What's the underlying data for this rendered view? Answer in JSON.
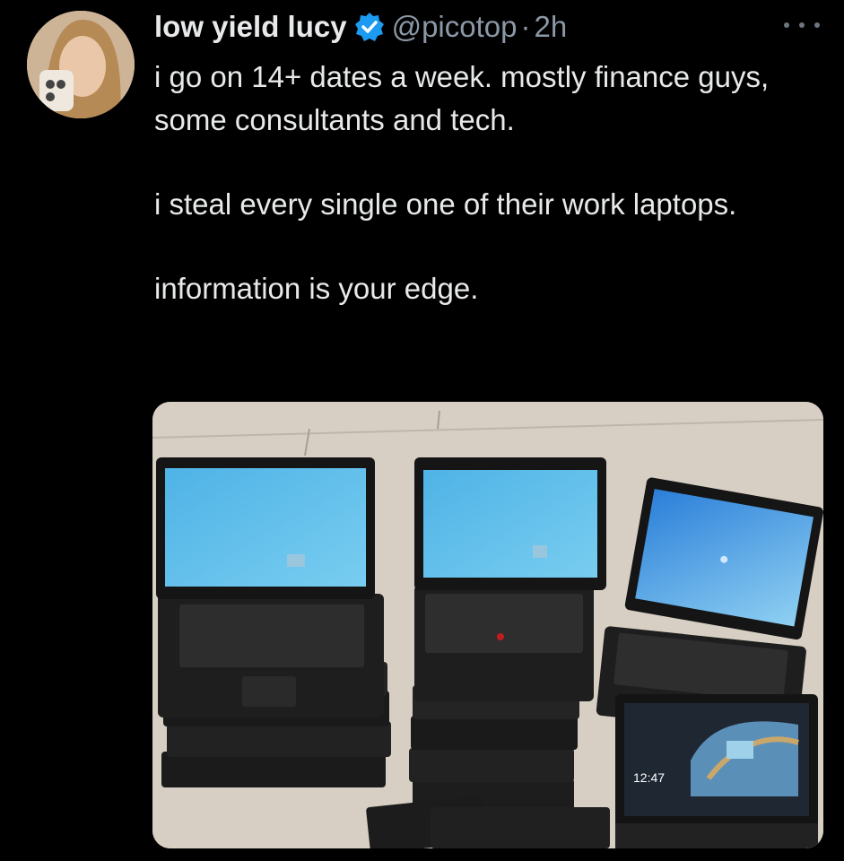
{
  "tweet": {
    "display_name": "low yield lucy",
    "handle": "@picotop",
    "separator": "·",
    "time": "2h",
    "text_lines": [
      "i go on 14+ dates a week. mostly finance guys, some consultants and tech.",
      "i steal every single one of their work laptops.",
      "information is your edge."
    ],
    "icons": {
      "verified": "verified-badge-icon",
      "more": "more-options-icon"
    },
    "colors": {
      "background": "#000000",
      "text": "#e7e9ea",
      "secondary_text": "#8b98a5",
      "verified": "#1d9bf0"
    }
  },
  "media": {
    "laptop_clock": "12:47"
  }
}
